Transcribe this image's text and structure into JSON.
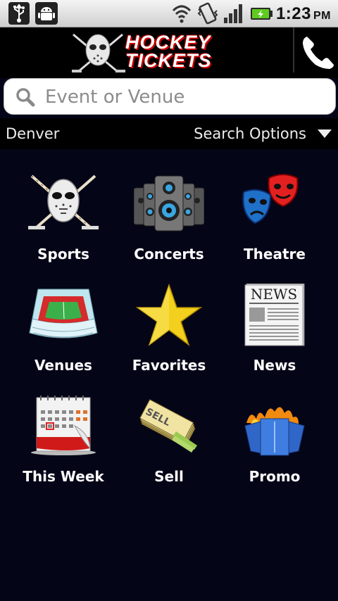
{
  "status_bar": {
    "time": "1:23",
    "ampm": "PM",
    "icons": [
      "usb-icon",
      "android-debug-icon",
      "wifi-icon",
      "vibrate-icon",
      "signal-icon",
      "battery-charging-icon"
    ]
  },
  "header": {
    "logo_line1": "HOCKEY",
    "logo_line2": "TICKETS"
  },
  "search": {
    "placeholder": "Event or Venue",
    "value": ""
  },
  "location": {
    "city": "Denver",
    "options_label": "Search Options"
  },
  "grid": [
    {
      "label": "Sports",
      "icon": "hockey-mask-icon"
    },
    {
      "label": "Concerts",
      "icon": "speakers-icon"
    },
    {
      "label": "Theatre",
      "icon": "theatre-masks-icon"
    },
    {
      "label": "Venues",
      "icon": "stadium-icon"
    },
    {
      "label": "Favorites",
      "icon": "star-icon"
    },
    {
      "label": "News",
      "icon": "newspaper-icon"
    },
    {
      "label": "This Week",
      "icon": "calendar-icon"
    },
    {
      "label": "Sell",
      "icon": "tickets-icon"
    },
    {
      "label": "Promo",
      "icon": "promo-tickets-icon"
    }
  ],
  "colors": {
    "background": "#050518",
    "header": "#000000",
    "accent_red": "#cc0000"
  }
}
